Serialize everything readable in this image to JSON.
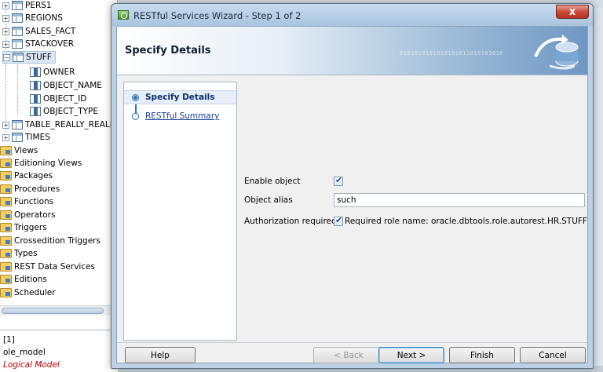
{
  "tree": {
    "items": [
      {
        "label": "PERS1",
        "icon": "table-icon",
        "toggle": "+"
      },
      {
        "label": "REGIONS",
        "icon": "table-icon",
        "toggle": "+"
      },
      {
        "label": "SALES_FACT",
        "icon": "table-icon",
        "toggle": "+"
      },
      {
        "label": "STACKOVER",
        "icon": "table-icon",
        "toggle": "+"
      },
      {
        "label": "STUFF",
        "icon": "table-icon",
        "toggle": "−"
      },
      {
        "label": "OWNER",
        "icon": "column-icon"
      },
      {
        "label": "OBJECT_NAME",
        "icon": "column-icon"
      },
      {
        "label": "OBJECT_ID",
        "icon": "column-icon"
      },
      {
        "label": "OBJECT_TYPE",
        "icon": "column-icon"
      },
      {
        "label": "TABLE_REALLY_REALL",
        "icon": "table-icon",
        "toggle": "+"
      },
      {
        "label": "TIMES",
        "icon": "table-icon",
        "toggle": "+"
      },
      {
        "label": "Views",
        "icon": "folder-icon"
      },
      {
        "label": "Editioning Views",
        "icon": "folder-icon"
      },
      {
        "label": "Packages",
        "icon": "folder-icon"
      },
      {
        "label": "Procedures",
        "icon": "folder-icon"
      },
      {
        "label": "Functions",
        "icon": "folder-icon"
      },
      {
        "label": "Operators",
        "icon": "folder-icon"
      },
      {
        "label": "Triggers",
        "icon": "folder-icon"
      },
      {
        "label": "Crossedition Triggers",
        "icon": "folder-icon"
      },
      {
        "label": "Types",
        "icon": "folder-icon"
      },
      {
        "label": "REST Data Services",
        "icon": "folder-icon"
      },
      {
        "label": "Editions",
        "icon": "folder-icon"
      },
      {
        "label": "Scheduler",
        "icon": "folder-icon"
      }
    ]
  },
  "bottom_panel": {
    "line1": "[1]",
    "line2": "ole_model",
    "line3": "Logical Model"
  },
  "dialog": {
    "title": "RESTful Services Wizard - Step 1 of 2",
    "close_label": "x",
    "banner_title": "Specify Details",
    "banner_binary": "0101010101010101011010101010",
    "steps": [
      {
        "label": "Specify Details",
        "current": true
      },
      {
        "label": "RESTful Summary",
        "current": false
      }
    ],
    "form": {
      "enable_label": "Enable object",
      "enable_checked": true,
      "alias_label": "Object alias",
      "alias_value": "such",
      "auth_label": "Authorization required",
      "auth_checked": true,
      "role_text": "Required role name: oracle.dbtools.role.autorest.HR.STUFF"
    },
    "buttons": {
      "help": "Help",
      "back": "< Back",
      "next": "Next >",
      "finish": "Finish",
      "cancel": "Cancel"
    }
  },
  "colors": {
    "accent": "#2f6fb3",
    "close": "#c9493a",
    "logical_model": "#c00000"
  }
}
